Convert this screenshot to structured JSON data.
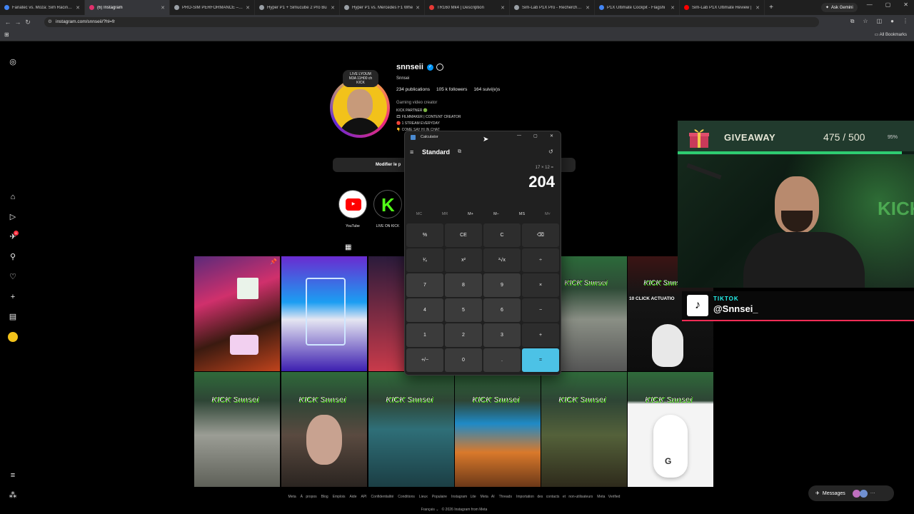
{
  "browser": {
    "tabs": [
      {
        "label": "Fanatec vs. Moza: Sim Racing M",
        "color": "#4285f4",
        "active": false
      },
      {
        "label": "(6) Instagram",
        "color": "#e1306c",
        "active": true
      },
      {
        "label": "PRO-SIM PERFORMANCE – Rac",
        "color": "#9aa0a6",
        "active": false
      },
      {
        "label": "Hyper P1 + Simucube 2 Pro Bu",
        "color": "#9aa0a6",
        "active": false
      },
      {
        "label": "Hyper P1 vs. Mercedes F1 Whe",
        "color": "#9aa0a6",
        "active": false
      },
      {
        "label": "TR160 Mk4 | Description",
        "color": "#e53935",
        "active": false
      },
      {
        "label": "Sim-Lab P1X Pro - Recherche G",
        "color": "#9aa0a6",
        "active": false
      },
      {
        "label": "P1X Ultimate Cockpit - Flagshi",
        "color": "#4285f4",
        "active": false
      },
      {
        "label": "Sim-Lab P1X Ultimate Review |",
        "color": "#ff0000",
        "active": false
      }
    ],
    "new_tab": "+",
    "gemini_label": "Ask Gemini",
    "url": "instagram.com/snnseii/?hl=fr",
    "all_bookmarks": "All Bookmarks"
  },
  "profile": {
    "username": "snnseii",
    "full_name": "Snnsei",
    "avatar_note": [
      "LIVE LYOUM",
      "M3A 11H00 ch",
      "KICK"
    ],
    "stats": [
      "234 publications",
      "105 k followers",
      "164 suivi(e)s"
    ],
    "category": "Gaming video creator",
    "bio": [
      "KICK PARTNER 🟢",
      "🎞 FILMMAKER | CONTENT CREATOR",
      "🔴 1 STREAM EVERYDAY",
      "👇 COME SAY HI IN CHAT"
    ],
    "edit_button": "Modifier le p",
    "highlights": [
      {
        "label": "YouTube"
      },
      {
        "label": "LIVE ON KICK"
      }
    ]
  },
  "posts": {
    "kick_text": "KICK Snnsei",
    "tile_text": "10 CLICK ACTUATIO"
  },
  "calculator": {
    "title": "Calculator",
    "mode": "Standard",
    "expression": "17 × 12 =",
    "display": "204",
    "memory": [
      "MC",
      "MR",
      "M+",
      "M−",
      "MS",
      "M˅"
    ],
    "keys": [
      [
        "%",
        "CE",
        "C",
        "⌫"
      ],
      [
        "¹⁄ₓ",
        "x²",
        "²√x",
        "÷"
      ],
      [
        "7",
        "8",
        "9",
        "×"
      ],
      [
        "4",
        "5",
        "6",
        "−"
      ],
      [
        "1",
        "2",
        "3",
        "+"
      ],
      [
        "+/−",
        "0",
        ".",
        "="
      ]
    ],
    "window_controls": [
      "—",
      "▢",
      "✕"
    ]
  },
  "overlay": {
    "giveaway_title": "GIVEAWAY",
    "giveaway_count": "475 / 500",
    "giveaway_percent": "95%",
    "giveaway_progress": 0.95,
    "tiktok_label": "TIKTOK",
    "tiktok_handle": "@Snnsei_"
  },
  "footer": {
    "links": [
      "Meta",
      "À propos",
      "Blog",
      "Emplois",
      "Aide",
      "API",
      "Confidentialité",
      "Conditions",
      "Lieux",
      "Populaire",
      "Instagram Lite",
      "Meta AI",
      "Threads",
      "Importation des contacts et non-utilisateurs",
      "Meta Verified"
    ],
    "language": "Français",
    "copyright": "© 2026 Instagram from Meta"
  },
  "messages": {
    "label": "Messages"
  }
}
